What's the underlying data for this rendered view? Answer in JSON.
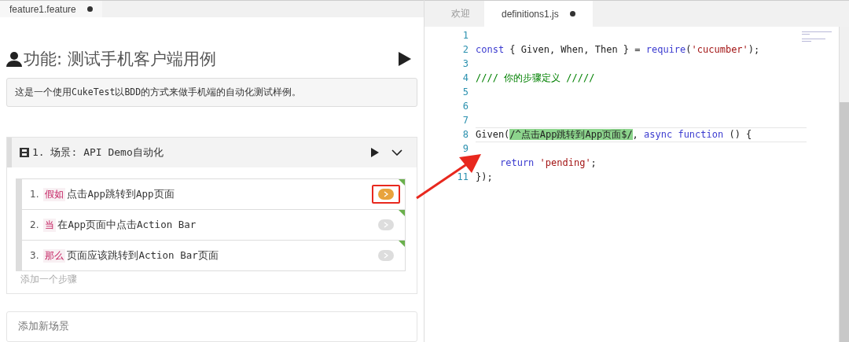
{
  "left_tabs": [
    {
      "label": "feature1.feature",
      "modified": true,
      "selected": true
    }
  ],
  "right_tabs": [
    {
      "label": "欢迎",
      "modified": false,
      "selected": false
    },
    {
      "label": "definitions1.js",
      "modified": true,
      "selected": true
    }
  ],
  "feature": {
    "title": "功能: 测试手机客户端用例",
    "description": "这是一个使用CukeTest以BDD的方式来做手机端的自动化测试样例。"
  },
  "scenario": {
    "title": "1. 场景: API Demo自动化",
    "expanded": true,
    "steps": [
      {
        "number": "1.",
        "keyword": "假如",
        "text": "点击App跳转到App页面",
        "active": true,
        "highlighted": true
      },
      {
        "number": "2.",
        "keyword": "当",
        "text": "在App页面中点击Action Bar",
        "active": false,
        "highlighted": false
      },
      {
        "number": "3.",
        "keyword": "那么",
        "text": "页面应该跳转到Action Bar页面",
        "active": false,
        "highlighted": false
      }
    ],
    "add_step": "添加一个步骤"
  },
  "add_scenario": "添加新场景",
  "code": [
    {
      "number": "1"
    },
    {
      "number": "2",
      "tokens": [
        {
          "kind": "kw",
          "text": "const"
        },
        {
          "kind": "plain",
          "text": " { Given, When, Then } = "
        },
        {
          "kind": "kw",
          "text": "require"
        },
        {
          "kind": "plain",
          "text": "("
        },
        {
          "kind": "str",
          "text": "'cucumber'"
        },
        {
          "kind": "plain",
          "text": ");"
        }
      ]
    },
    {
      "number": "3"
    },
    {
      "number": "4",
      "tokens": [
        {
          "kind": "comment",
          "text": "//// 你的步骤定义 /////"
        }
      ]
    },
    {
      "number": "5"
    },
    {
      "number": "6"
    },
    {
      "number": "7"
    },
    {
      "number": "8",
      "current": true,
      "tokens": [
        {
          "kind": "plain",
          "text": "Given("
        },
        {
          "kind": "regex",
          "text": "/^点击App跳转到App页面$/"
        },
        {
          "kind": "plain",
          "text": ", "
        },
        {
          "kind": "kw",
          "text": "async function"
        },
        {
          "kind": "plain",
          "text": " () {"
        }
      ]
    },
    {
      "number": "9"
    },
    {
      "indented": true,
      "tokens": [
        {
          "kind": "kw",
          "text": "return"
        },
        {
          "kind": "str",
          "text": " 'pending'"
        },
        {
          "kind": "plain",
          "text": ";"
        }
      ]
    },
    {
      "number": "11",
      "tokens": [
        {
          "kind": "plain",
          "text": "});"
        }
      ]
    }
  ]
}
